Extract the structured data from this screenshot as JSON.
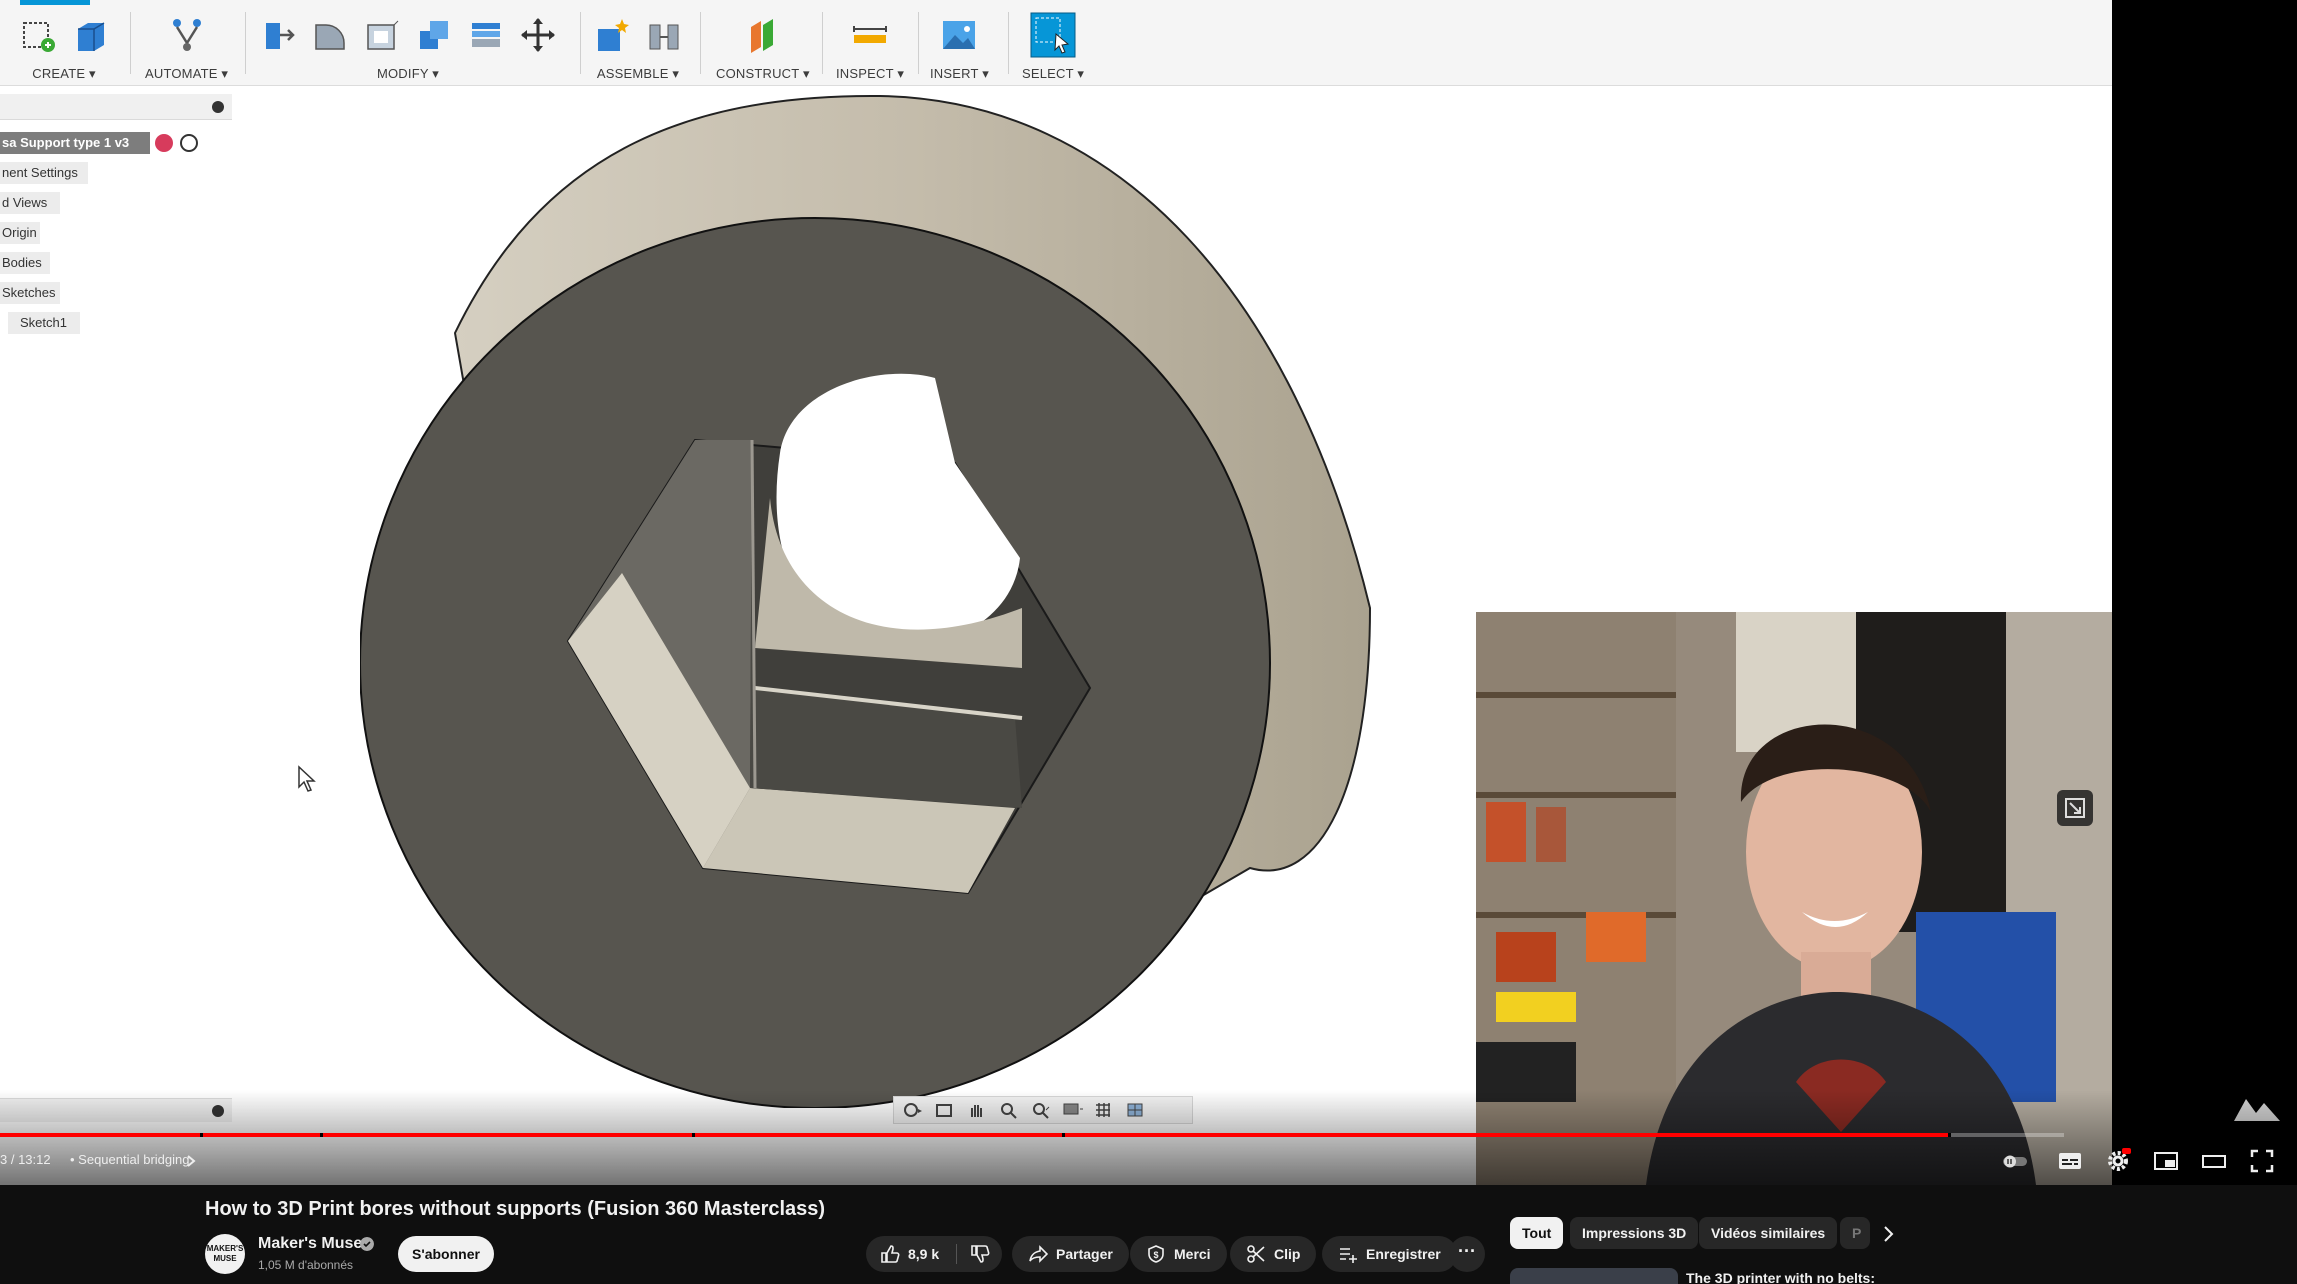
{
  "fusion": {
    "toolbar_groups": [
      {
        "label": "CREATE ▾"
      },
      {
        "label": "AUTOMATE ▾"
      },
      {
        "label": "MODIFY ▾"
      },
      {
        "label": "ASSEMBLE ▾"
      },
      {
        "label": "CONSTRUCT ▾"
      },
      {
        "label": "INSPECT ▾"
      },
      {
        "label": "INSERT ▾"
      },
      {
        "label": "SELECT ▾"
      }
    ],
    "browser": {
      "root": "sa Support type 1 v3",
      "items": [
        "nent Settings",
        "d Views",
        "Origin",
        "Bodies",
        "Sketches",
        "Sketch1"
      ]
    },
    "colors": {
      "accent": "#0696d7",
      "model_face": "#585650",
      "model_side": "#c8c1b2"
    }
  },
  "player": {
    "time": "3 / 13:12",
    "chapter": "• Sequential bridging",
    "progress_fraction": 0.944,
    "brand_icon": "makers-muse-logo"
  },
  "video": {
    "title": "How to 3D Print bores without supports (Fusion 360 Masterclass)",
    "channel": "Maker's Muse",
    "avatar_text": "MAKER'S MUSE",
    "subscribers": "1,05 M d'abonnés",
    "subscribe_label": "S'abonner",
    "likes": "8,9 k",
    "actions": {
      "share": "Partager",
      "thanks": "Merci",
      "clip": "Clip",
      "save": "Enregistrer",
      "more": "···"
    }
  },
  "chips": [
    "Tout",
    "Impressions 3D",
    "Vidéos similaires",
    "P"
  ],
  "recommendation": {
    "title": "The 3D printer with no belts:"
  }
}
